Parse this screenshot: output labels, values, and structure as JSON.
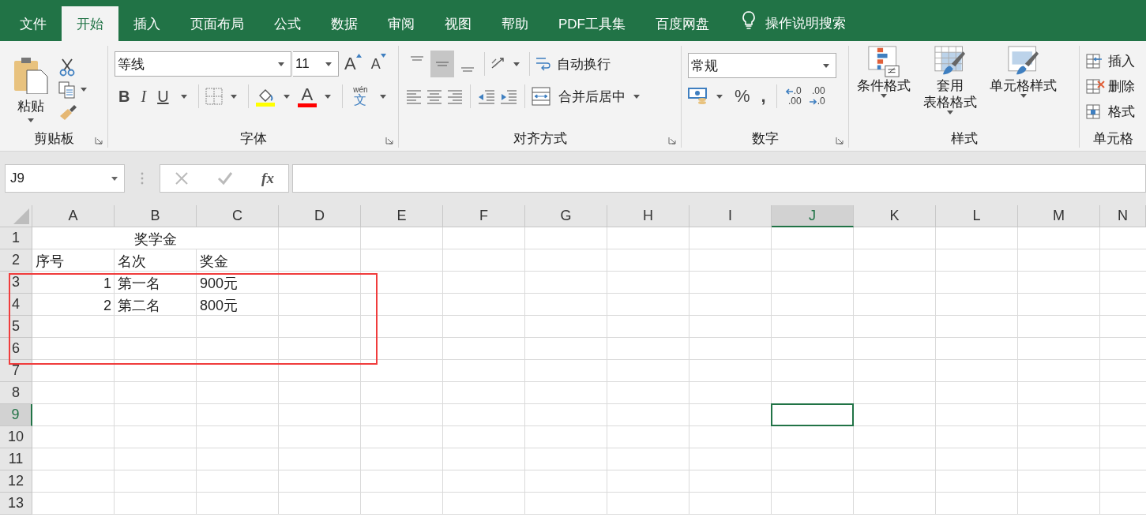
{
  "tabs": [
    {
      "label": "文件",
      "selected": false
    },
    {
      "label": "开始",
      "selected": true
    },
    {
      "label": "插入",
      "selected": false
    },
    {
      "label": "页面布局",
      "selected": false
    },
    {
      "label": "公式",
      "selected": false
    },
    {
      "label": "数据",
      "selected": false
    },
    {
      "label": "审阅",
      "selected": false
    },
    {
      "label": "视图",
      "selected": false
    },
    {
      "label": "帮助",
      "selected": false
    },
    {
      "label": "PDF工具集",
      "selected": false
    },
    {
      "label": "百度网盘",
      "selected": false
    }
  ],
  "tell_me": "操作说明搜索",
  "ribbon": {
    "clipboard": {
      "label": "剪贴板",
      "paste": "粘贴"
    },
    "font": {
      "label": "字体",
      "font_name": "等线",
      "font_size": "11",
      "grow": "A",
      "shrink": "A",
      "bold": "B",
      "italic": "I",
      "underline": "U",
      "font_color": "A",
      "phonetic_top": "wén",
      "phonetic_char": "文"
    },
    "alignment": {
      "label": "对齐方式",
      "vertical_align": [
        {
          "selected": false
        },
        {
          "selected": true
        },
        {
          "selected": false
        }
      ],
      "wrap_text": "自动换行",
      "merge_center": "合并后居中"
    },
    "number": {
      "label": "数字",
      "format": "常规",
      "percent": "%",
      "comma": ",",
      "increase_decimal": [
        ".0",
        ".00"
      ],
      "decrease_decimal": [
        ".00",
        ".0"
      ]
    },
    "styles": {
      "label": "样式",
      "buttons": [
        {
          "lines": [
            "条件格式"
          ]
        },
        {
          "lines": [
            "套用",
            "表格格式"
          ]
        },
        {
          "lines": [
            "单元格样式"
          ]
        }
      ]
    },
    "cells": {
      "label": "单元格",
      "buttons": [
        "插入",
        "删除",
        "格式"
      ]
    }
  },
  "name_box": "J9",
  "formula_bar": {
    "fx": "fx"
  },
  "sheet": {
    "columns": [
      {
        "label": "A",
        "selected": false
      },
      {
        "label": "B",
        "selected": false
      },
      {
        "label": "C",
        "selected": false
      },
      {
        "label": "D",
        "selected": false
      },
      {
        "label": "E",
        "selected": false
      },
      {
        "label": "F",
        "selected": false
      },
      {
        "label": "G",
        "selected": false
      },
      {
        "label": "H",
        "selected": false
      },
      {
        "label": "I",
        "selected": false
      },
      {
        "label": "J",
        "selected": true
      },
      {
        "label": "K",
        "selected": false
      },
      {
        "label": "L",
        "selected": false
      },
      {
        "label": "M",
        "selected": false
      },
      {
        "label": "N",
        "selected": false
      }
    ],
    "rows": [
      {
        "label": "1",
        "selected": false,
        "title": "奖学金"
      },
      {
        "label": "2",
        "selected": false,
        "cells": [
          "序号",
          "名次",
          "奖金"
        ]
      },
      {
        "label": "3",
        "selected": false,
        "cells": [
          "1",
          "第一名",
          "900元"
        ]
      },
      {
        "label": "4",
        "selected": false,
        "cells": [
          "2",
          "第二名",
          "800元"
        ]
      },
      {
        "label": "5",
        "selected": false
      },
      {
        "label": "6",
        "selected": false
      },
      {
        "label": "7",
        "selected": false
      },
      {
        "label": "8",
        "selected": false
      },
      {
        "label": "9",
        "selected": true
      },
      {
        "label": "10",
        "selected": false
      },
      {
        "label": "11",
        "selected": false
      },
      {
        "label": "12",
        "selected": false
      },
      {
        "label": "13",
        "selected": false
      }
    ]
  }
}
